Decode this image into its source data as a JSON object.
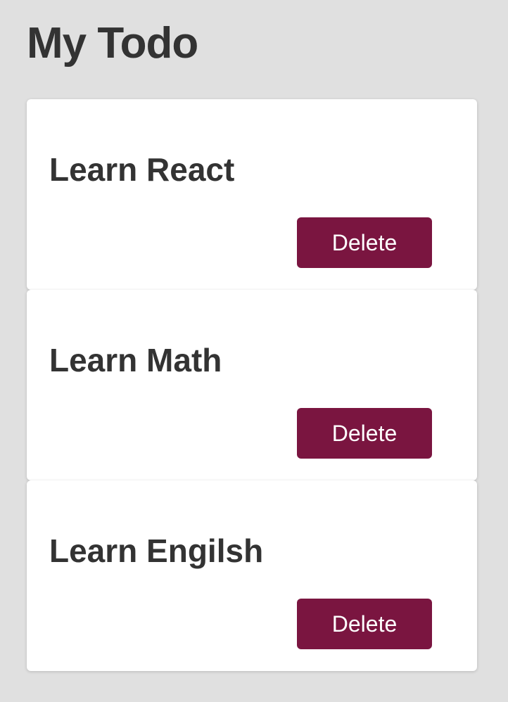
{
  "header": {
    "title": "My Todo"
  },
  "todos": [
    {
      "title": "Learn React",
      "delete_label": "Delete"
    },
    {
      "title": "Learn Math",
      "delete_label": "Delete"
    },
    {
      "title": "Learn Engilsh",
      "delete_label": "Delete"
    }
  ],
  "colors": {
    "background": "#e0e0e0",
    "card": "#ffffff",
    "text": "#333333",
    "accent": "#7a1540"
  }
}
